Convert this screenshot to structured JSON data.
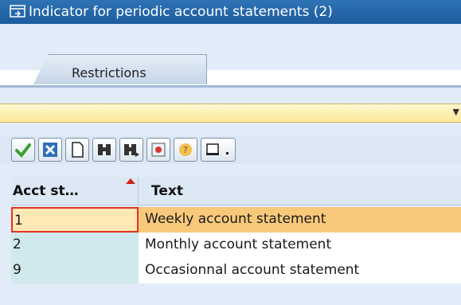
{
  "window": {
    "title": "Indicator for periodic account statements (2)"
  },
  "tabs": [
    {
      "label": "Restrictions"
    }
  ],
  "toolbar": {
    "buttons": [
      {
        "icon": "check-icon"
      },
      {
        "icon": "cancel-icon"
      },
      {
        "icon": "new-document-icon"
      },
      {
        "icon": "find-icon"
      },
      {
        "icon": "find-next-icon"
      },
      {
        "icon": "sap-icon"
      },
      {
        "icon": "help-icon"
      },
      {
        "icon": "print-icon"
      }
    ]
  },
  "grid": {
    "columns": [
      "Acct st…",
      "Text"
    ],
    "rows": [
      {
        "key": "1",
        "text": "Weekly account statement",
        "selected": true
      },
      {
        "key": "2",
        "text": "Monthly account statement",
        "selected": false
      },
      {
        "key": "9",
        "text": "Occasionnal account statement",
        "selected": false
      }
    ]
  },
  "colors": {
    "title_bar": "#2e73b5",
    "selected_row": "#f9c97b",
    "key_column": "#cfe9ec",
    "sort_indicator": "#d21f1f"
  }
}
